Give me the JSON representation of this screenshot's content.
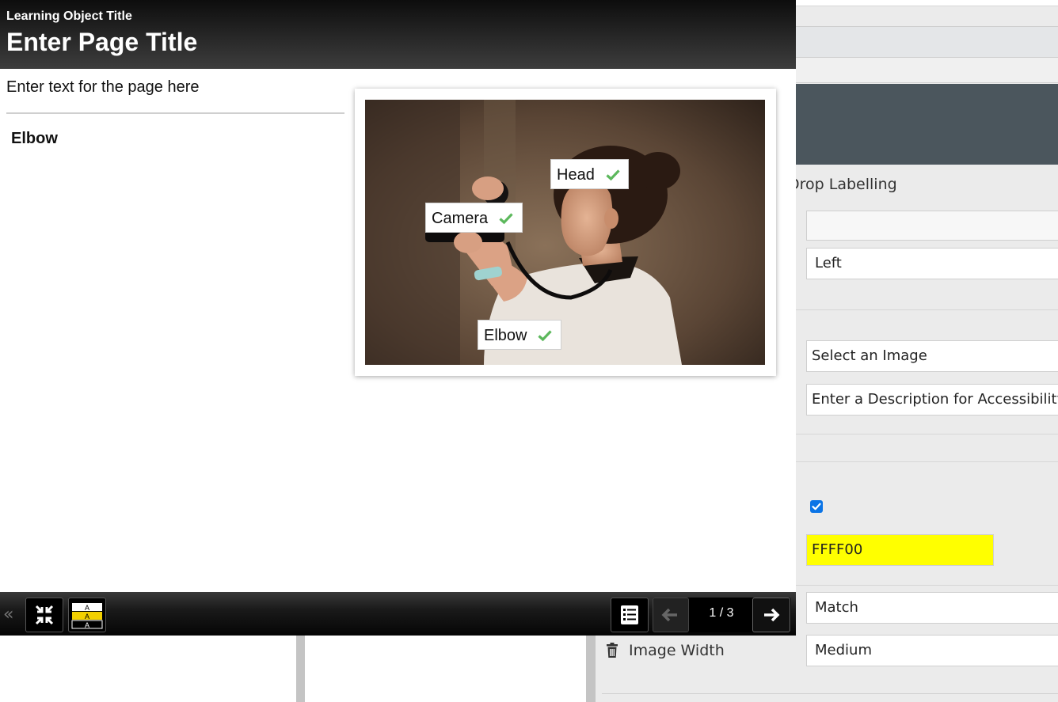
{
  "editor": {
    "panel_title_fragment": "Drop Labelling",
    "fields": {
      "position": "Left",
      "image": "Select an Image",
      "description": "Enter a Description for Accessibility",
      "highlight_color": "FFFF00",
      "match_mode": "Match",
      "image_width": "Medium"
    },
    "image_width_label": "Image Width",
    "checkbox_checked": true
  },
  "preview": {
    "learning_object_title": "Learning Object Title",
    "page_title": "Enter Page Title",
    "body_text": "Enter text for the page here",
    "drag_label": "Elbow",
    "hotspots": [
      {
        "label": "Head"
      },
      {
        "label": "Camera"
      },
      {
        "label": "Elbow"
      }
    ],
    "page_counter": "1 / 3"
  },
  "colors": {
    "check_green": "#5cb85c",
    "highlight": "#ffff00",
    "editor_header": "#4b565d"
  },
  "icons": [
    "collapse-icon",
    "minimize-icon",
    "contrast-icon",
    "list-icon",
    "arrow-left-icon",
    "arrow-right-icon",
    "trash-icon",
    "checkmark-icon"
  ]
}
